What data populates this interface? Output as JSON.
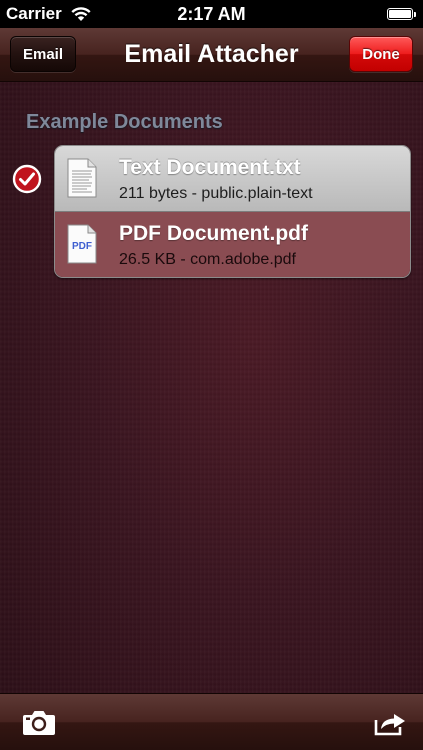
{
  "status_bar": {
    "carrier": "Carrier",
    "time": "2:17 AM",
    "battery_level": 1.0
  },
  "nav_bar": {
    "title": "Email Attacher",
    "left_button_label": "Email",
    "right_button_label": "Done"
  },
  "section": {
    "header": "Example Documents",
    "items": [
      {
        "title": "Text Document.txt",
        "subtitle": "211 bytes - public.plain-text",
        "icon": "text-file-icon",
        "checked": true
      },
      {
        "title": "PDF Document.pdf",
        "subtitle": "26.5 KB - com.adobe.pdf",
        "icon": "pdf-file-icon",
        "icon_label": "PDF",
        "checked": false
      }
    ]
  },
  "toolbar": {
    "left_icon": "camera-icon",
    "right_icon": "share-icon"
  },
  "colors": {
    "done_button": "#e81717",
    "section_header": "#7f889a",
    "selected_row": "#8a4c52",
    "background": "#3a1620"
  }
}
